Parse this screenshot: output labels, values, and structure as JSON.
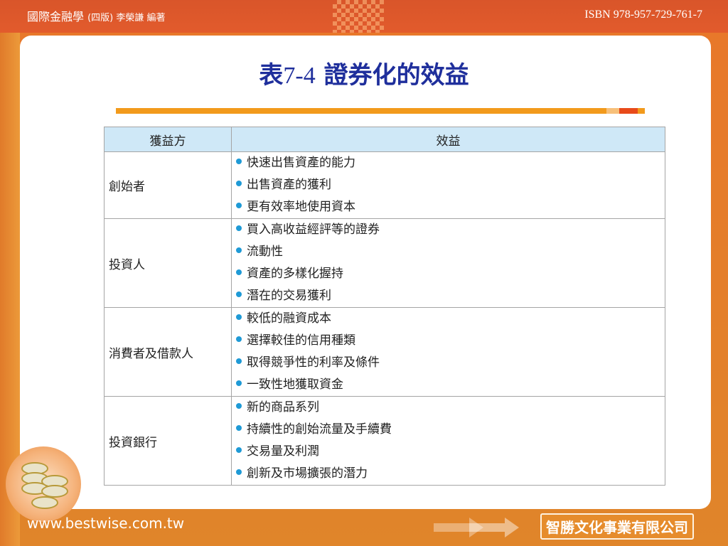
{
  "header": {
    "book_title": "國際金融學",
    "book_subtitle": "(四版) 李榮謙 編著",
    "isbn": "ISBN 978-957-729-761-7"
  },
  "slide": {
    "title_prefix": "表",
    "title_number": "7-4",
    "title_text": "證券化的效益"
  },
  "table": {
    "headers": [
      "獲益方",
      "效益"
    ],
    "rows": [
      {
        "party": "創始者",
        "benefits": [
          "快速出售資產的能力",
          "出售資產的獲利",
          "更有效率地使用資本"
        ]
      },
      {
        "party": "投資人",
        "benefits": [
          "買入高收益經評等的證券",
          "流動性",
          "資產的多樣化握持",
          "潛在的交易獲利"
        ]
      },
      {
        "party": "消費者及借款人",
        "benefits": [
          "較低的融資成本",
          "選擇較佳的信用種類",
          "取得競爭性的利率及條件",
          "一致性地獲取資金"
        ]
      },
      {
        "party": "投資銀行",
        "benefits": [
          "新的商品系列",
          "持續性的創始流量及手續費",
          "交易量及利潤",
          "創新及市場擴張的潛力"
        ]
      }
    ]
  },
  "footer": {
    "url": "www.bestwise.com.tw",
    "publisher": "智勝文化事業有限公司"
  },
  "colors": {
    "header_bg": "#d9552a",
    "title_color": "#1f2f9c",
    "table_header_bg": "#cfe8f7",
    "bullet_color": "#1f9ad6",
    "accent_orange": "#f29a1c"
  }
}
